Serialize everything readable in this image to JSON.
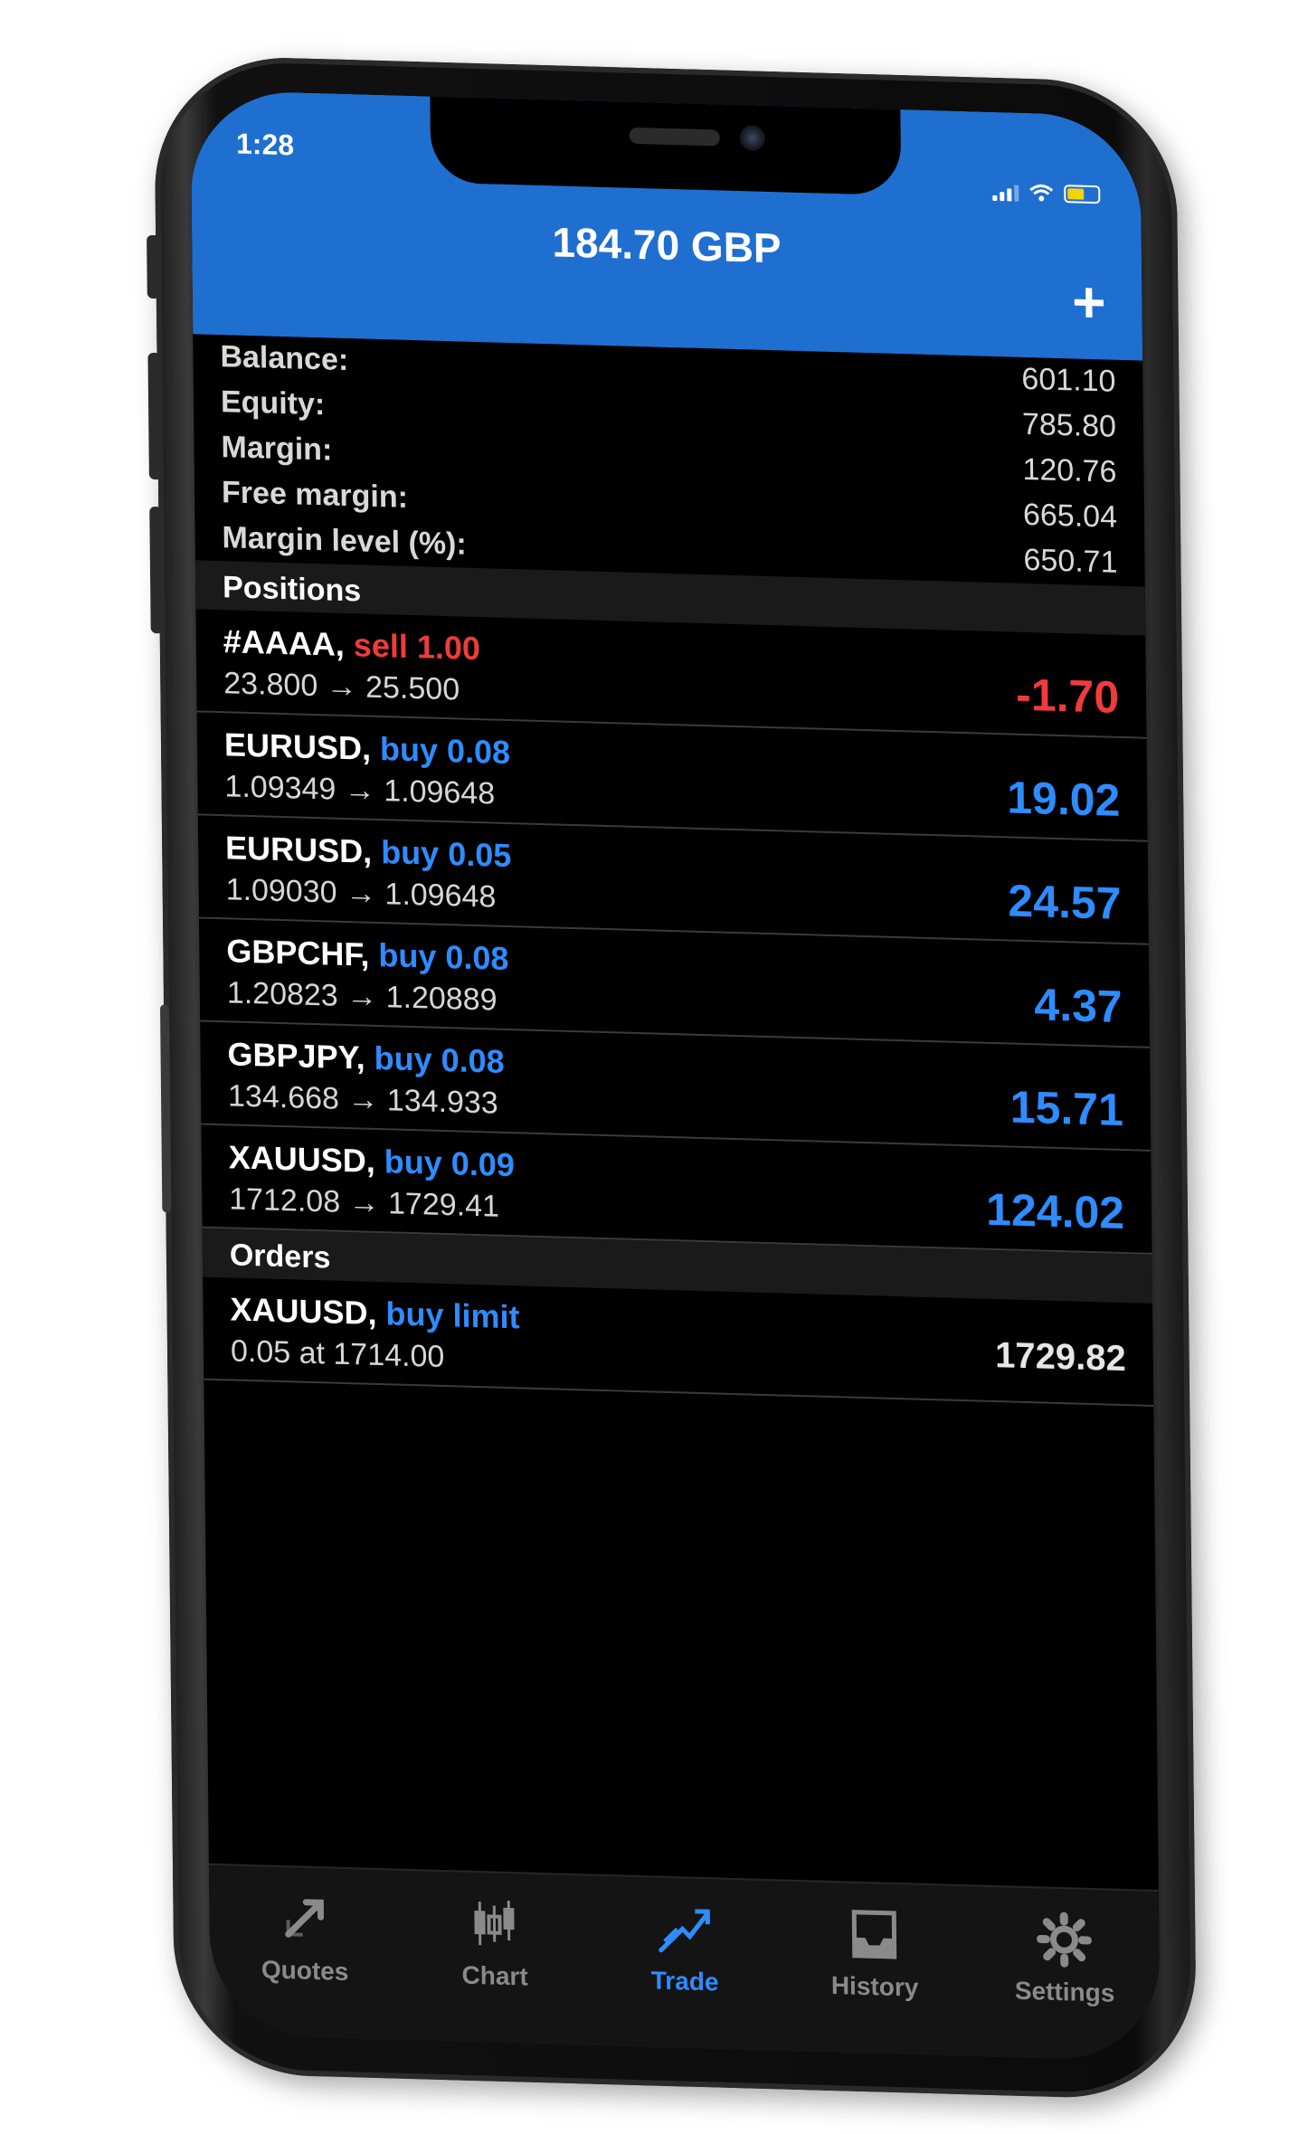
{
  "status_bar": {
    "time": "1:28"
  },
  "header": {
    "balance_title": "184.70 GBP",
    "add_label": "+"
  },
  "summary": [
    {
      "label": "Balance:",
      "value": "601.10"
    },
    {
      "label": "Equity:",
      "value": "785.80"
    },
    {
      "label": "Margin:",
      "value": "120.76"
    },
    {
      "label": "Free margin:",
      "value": "665.04"
    },
    {
      "label": "Margin level (%):",
      "value": "650.71"
    }
  ],
  "positions": {
    "title": "Positions",
    "items": [
      {
        "symbol": "#AAAA,",
        "direction": "sell 1.00",
        "type": "sell",
        "prices": "23.800 → 25.500",
        "pl": "-1.70",
        "pl_state": "neg"
      },
      {
        "symbol": "EURUSD,",
        "direction": "buy 0.08",
        "type": "buy",
        "prices": "1.09349 → 1.09648",
        "pl": "19.02",
        "pl_state": "pos"
      },
      {
        "symbol": "EURUSD,",
        "direction": "buy 0.05",
        "type": "buy",
        "prices": "1.09030 → 1.09648",
        "pl": "24.57",
        "pl_state": "pos"
      },
      {
        "symbol": "GBPCHF,",
        "direction": "buy 0.08",
        "type": "buy",
        "prices": "1.20823 → 1.20889",
        "pl": "4.37",
        "pl_state": "pos"
      },
      {
        "symbol": "GBPJPY,",
        "direction": "buy 0.08",
        "type": "buy",
        "prices": "134.668 → 134.933",
        "pl": "15.71",
        "pl_state": "pos"
      },
      {
        "symbol": "XAUUSD,",
        "direction": "buy 0.09",
        "type": "buy",
        "prices": "1712.08 → 1729.41",
        "pl": "124.02",
        "pl_state": "pos"
      }
    ]
  },
  "orders": {
    "title": "Orders",
    "items": [
      {
        "symbol": "XAUUSD,",
        "direction": "buy limit",
        "type": "buy",
        "prices": "0.05 at 1714.00",
        "pl": "1729.82",
        "pl_state": "neutral"
      }
    ]
  },
  "tabbar": [
    {
      "label": "Quotes",
      "icon": "quotes-icon",
      "active": false
    },
    {
      "label": "Chart",
      "icon": "chart-icon",
      "active": false
    },
    {
      "label": "Trade",
      "icon": "trade-icon",
      "active": true
    },
    {
      "label": "History",
      "icon": "history-icon",
      "active": false
    },
    {
      "label": "Settings",
      "icon": "settings-icon",
      "active": false
    }
  ],
  "colors": {
    "header_blue": "#1f6fd1",
    "buy_blue": "#2f8cff",
    "sell_red": "#ee3b3b",
    "battery_yellow": "#f5d20a"
  }
}
